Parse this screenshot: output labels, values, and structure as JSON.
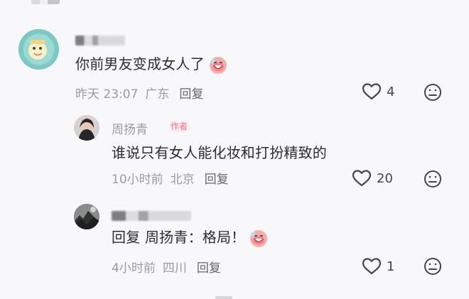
{
  "comments": [
    {
      "name": "",
      "content": "你前男友变成女人了",
      "emoji": "laughing-emoji",
      "meta": {
        "time": "昨天 23:07",
        "location": "广东",
        "reply": "回复"
      },
      "likes": "4"
    },
    {
      "name": "周扬青",
      "badge": "作者",
      "content": "谁说只有女人能化妆和打扮精致的",
      "meta": {
        "time": "10小时前",
        "location": "北京",
        "reply": "回复"
      },
      "likes": "20"
    },
    {
      "name": "",
      "content_prefix": "回复",
      "content": "周扬青：格局！",
      "emoji": "laughing-emoji",
      "meta": {
        "time": "4小时前",
        "location": "四川",
        "reply": "回复"
      },
      "likes": "1"
    }
  ]
}
